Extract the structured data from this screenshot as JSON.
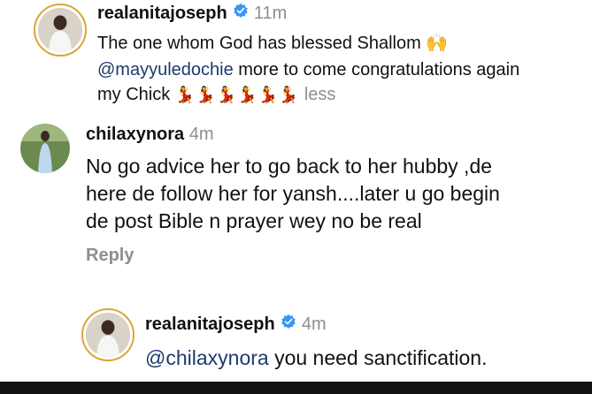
{
  "comments": [
    {
      "username": "realanitajoseph",
      "verified": true,
      "time": "11m",
      "line1": "The one whom God has blessed Shallom",
      "line1_emoji": "🙌",
      "mention": "@mayyuledochie",
      "line2_rest": " more to come congratulations again",
      "line3": "my Chick",
      "line3_emoji": "💃💃💃💃💃💃",
      "less": "less"
    },
    {
      "username": "chilaxynora",
      "time": "4m",
      "text_line1": "No go advice her to go back to her hubby ,de",
      "text_line2": "here de follow her for yansh....later u go begin",
      "text_line3": "de post Bible n prayer wey no be real",
      "reply": "Reply"
    },
    {
      "username": "realanitajoseph",
      "verified": true,
      "time": "4m",
      "mention": "@chilaxynora",
      "text": " you need sanctification."
    }
  ],
  "colors": {
    "verified_blue": "#3897f0",
    "mention": "#1d3a6e",
    "muted": "#8e8e8e",
    "ring": "#d9a63a"
  }
}
